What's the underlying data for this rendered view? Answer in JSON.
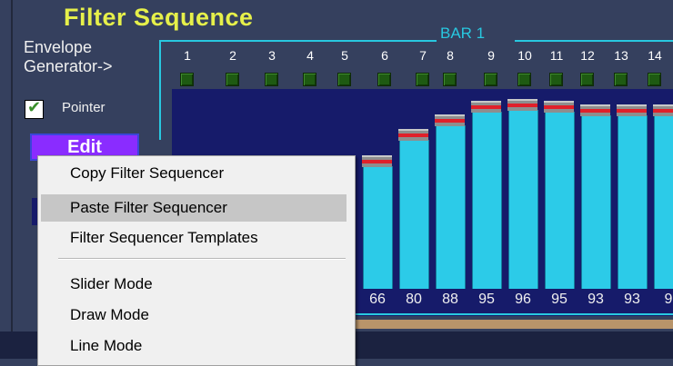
{
  "window": {
    "title": "Filter Sequence",
    "envelope_label": "Envelope Generator->",
    "bar_label": "BAR 1"
  },
  "pointer": {
    "checked": true,
    "label": "Pointer"
  },
  "edit_button": {
    "label": "Edit"
  },
  "steps": [
    "1",
    "2",
    "3",
    "4",
    "5",
    "6",
    "7",
    "8",
    "9",
    "10",
    "11",
    "12",
    "13",
    "14"
  ],
  "sequence_values": [
    {
      "label": "66",
      "value": 66
    },
    {
      "label": "80",
      "value": 80
    },
    {
      "label": "88",
      "value": 88
    },
    {
      "label": "95",
      "value": 95
    },
    {
      "label": "96",
      "value": 96
    },
    {
      "label": "95",
      "value": 95
    },
    {
      "label": "93",
      "value": 93
    },
    {
      "label": "93",
      "value": 93
    },
    {
      "label": "9",
      "value": 93
    }
  ],
  "context_menu": {
    "items": [
      {
        "label": "Copy Filter Sequencer"
      },
      {
        "label": "Paste  Filter Sequencer"
      },
      {
        "label": "Filter Sequencer Templates"
      },
      {
        "label": "Slider Mode"
      },
      {
        "label": "Draw Mode"
      },
      {
        "label": "Line Mode"
      }
    ],
    "highlighted_index": 1
  },
  "colors": {
    "title": "#e6f04a",
    "accent": "#28c8e0",
    "bar": "#2ccbe8",
    "plot_bg": "#161b6a",
    "edit_button": "#8a2cff"
  }
}
